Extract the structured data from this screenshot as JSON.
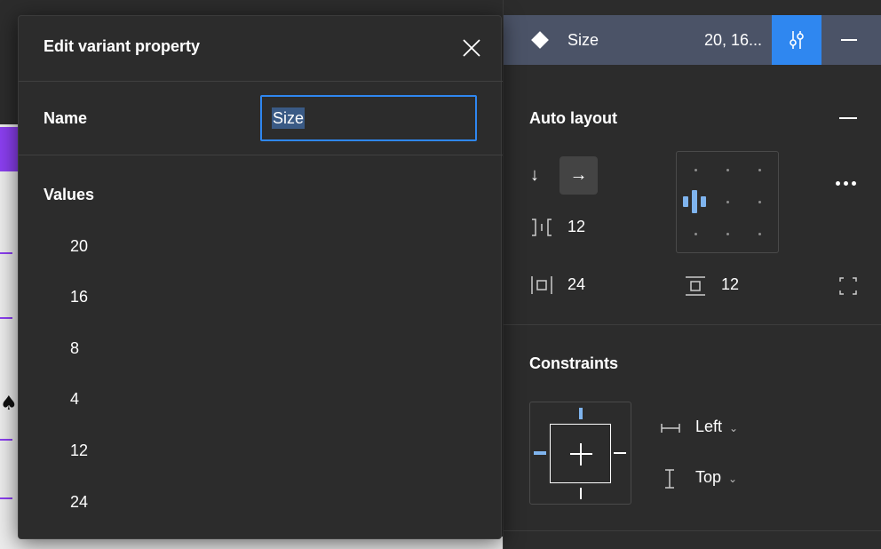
{
  "modal": {
    "title": "Edit variant property",
    "name_label": "Name",
    "name_value": "Size",
    "values_label": "Values",
    "values": [
      "20",
      "16",
      "8",
      "4",
      "12",
      "24"
    ]
  },
  "variant": {
    "property_name": "Size",
    "property_values": "20, 16..."
  },
  "auto_layout": {
    "title": "Auto layout",
    "spacing": "12",
    "horizontal_padding": "24",
    "vertical_padding": "12"
  },
  "constraints": {
    "title": "Constraints",
    "horizontal": "Left",
    "vertical": "Top"
  },
  "colors": {
    "accent": "#2f87f0",
    "selected_row": "#4b5367",
    "panel_bg": "#2c2c2c",
    "constraint_active": "#7fb4ee"
  }
}
